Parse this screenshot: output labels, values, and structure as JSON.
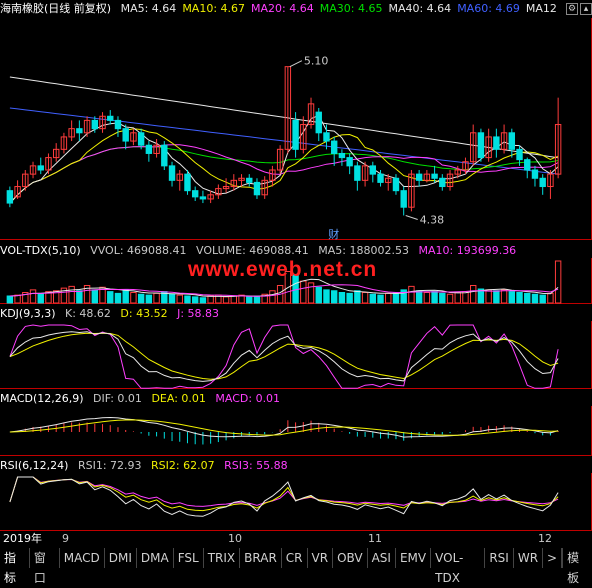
{
  "header": {
    "stock_name": "海南橡胶(日线 前复权)",
    "ma_items": [
      {
        "label": "MA5: 4.64",
        "color": "#e8e8e8"
      },
      {
        "label": "MA10: 4.67",
        "color": "#f0f000"
      },
      {
        "label": "MA20: 4.64",
        "color": "#ff40ff"
      },
      {
        "label": "MA30: 4.65",
        "color": "#00e000"
      },
      {
        "label": "MA40: 4.64",
        "color": "#e8e8e8"
      },
      {
        "label": "MA60: 4.69",
        "color": "#4060ff"
      },
      {
        "label": "MA12",
        "color": "#e8e8e8"
      }
    ]
  },
  "annotations": {
    "high": "5.10",
    "low": "4.38",
    "event": "财"
  },
  "volume_header": {
    "name": "VOL-TDX(5,10)",
    "vvol": "VVOL: 469088.41",
    "volume": "VOLUME: 469088.41",
    "ma5": "MA5: 188002.53",
    "ma10": "MA10: 193699.36"
  },
  "watermark": "www.eweb.net.cn",
  "kdj_header": {
    "name": "KDJ(9,3,3)",
    "k": "K: 48.62",
    "d": "D: 43.52",
    "j": "J: 58.83"
  },
  "macd_header": {
    "name": "MACD(12,26,9)",
    "dif": "DIF: 0.01",
    "dea": "DEA: 0.01",
    "macd": "MACD: 0.01"
  },
  "rsi_header": {
    "name": "RSI(6,12,24)",
    "rsi1": "RSI1: 72.93",
    "rsi2": "RSI2: 62.07",
    "rsi3": "RSI3: 55.88"
  },
  "dates": {
    "year": "2019年",
    "m9": "9",
    "m10": "10",
    "m11": "11",
    "m12": "12"
  },
  "tabs": [
    "指标",
    "窗口",
    "MACD",
    "DMI",
    "DMA",
    "FSL",
    "TRIX",
    "BRAR",
    "CR",
    "VR",
    "OBV",
    "ASI",
    "EMV",
    "VOL-TDX",
    "RSI",
    "WR",
    ">"
  ],
  "template_tab": "模板",
  "colors": {
    "up": "#ff3c3c",
    "down": "#00e0e0",
    "bg": "#000000",
    "grid": "#c00000"
  },
  "chart_data": {
    "type": "candlestick",
    "ylim": [
      4.3,
      5.2
    ],
    "candles": [
      [
        4.5,
        4.44,
        4.52,
        4.42
      ],
      [
        4.47,
        4.52,
        4.55,
        4.46
      ],
      [
        4.52,
        4.58,
        4.6,
        4.5
      ],
      [
        4.58,
        4.62,
        4.64,
        4.56
      ],
      [
        4.62,
        4.6,
        4.66,
        4.58
      ],
      [
        4.6,
        4.66,
        4.68,
        4.58
      ],
      [
        4.66,
        4.7,
        4.73,
        4.64
      ],
      [
        4.7,
        4.76,
        4.78,
        4.68
      ],
      [
        4.76,
        4.8,
        4.84,
        4.74
      ],
      [
        4.8,
        4.78,
        4.84,
        4.74
      ],
      [
        4.78,
        4.84,
        4.86,
        4.76
      ],
      [
        4.84,
        4.8,
        4.86,
        4.78
      ],
      [
        4.8,
        4.86,
        4.88,
        4.78
      ],
      [
        4.86,
        4.84,
        4.89,
        4.82
      ],
      [
        4.84,
        4.8,
        4.86,
        4.76
      ],
      [
        4.8,
        4.74,
        4.82,
        4.7
      ],
      [
        4.74,
        4.78,
        4.8,
        4.72
      ],
      [
        4.78,
        4.72,
        4.8,
        4.7
      ],
      [
        4.72,
        4.68,
        4.74,
        4.64
      ],
      [
        4.68,
        4.72,
        4.75,
        4.66
      ],
      [
        4.72,
        4.62,
        4.74,
        4.6
      ],
      [
        4.62,
        4.55,
        4.64,
        4.52
      ],
      [
        4.55,
        4.58,
        4.6,
        4.5
      ],
      [
        4.58,
        4.5,
        4.6,
        4.48
      ],
      [
        4.5,
        4.47,
        4.52,
        4.45
      ],
      [
        4.47,
        4.46,
        4.5,
        4.44
      ],
      [
        4.46,
        4.48,
        4.5,
        4.44
      ],
      [
        4.48,
        4.51,
        4.53,
        4.46
      ],
      [
        4.51,
        4.52,
        4.56,
        4.49
      ],
      [
        4.52,
        4.55,
        4.58,
        4.5
      ],
      [
        4.55,
        4.56,
        4.58,
        4.52
      ],
      [
        4.56,
        4.54,
        4.58,
        4.52
      ],
      [
        4.54,
        4.48,
        4.56,
        4.46
      ],
      [
        4.48,
        4.55,
        4.57,
        4.46
      ],
      [
        4.55,
        4.6,
        4.62,
        4.52
      ],
      [
        4.6,
        4.7,
        4.72,
        4.58
      ],
      [
        4.7,
        5.1,
        5.1,
        4.68
      ],
      [
        4.84,
        4.7,
        4.88,
        4.66
      ],
      [
        4.7,
        4.82,
        4.86,
        4.68
      ],
      [
        4.82,
        4.92,
        4.95,
        4.8
      ],
      [
        4.88,
        4.78,
        4.9,
        4.74
      ],
      [
        4.78,
        4.74,
        4.82,
        4.7
      ],
      [
        4.74,
        4.68,
        4.76,
        4.62
      ],
      [
        4.68,
        4.66,
        4.7,
        4.62
      ],
      [
        4.66,
        4.62,
        4.68,
        4.58
      ],
      [
        4.62,
        4.55,
        4.64,
        4.5
      ],
      [
        4.55,
        4.62,
        4.64,
        4.52
      ],
      [
        4.62,
        4.58,
        4.64,
        4.54
      ],
      [
        4.58,
        4.54,
        4.6,
        4.52
      ],
      [
        4.54,
        4.56,
        4.58,
        4.5
      ],
      [
        4.56,
        4.5,
        4.58,
        4.48
      ],
      [
        4.5,
        4.42,
        4.52,
        4.38
      ],
      [
        4.42,
        4.58,
        4.6,
        4.4
      ],
      [
        4.58,
        4.55,
        4.6,
        4.52
      ],
      [
        4.55,
        4.58,
        4.6,
        4.54
      ],
      [
        4.58,
        4.56,
        4.62,
        4.54
      ],
      [
        4.56,
        4.52,
        4.58,
        4.5
      ],
      [
        4.52,
        4.58,
        4.6,
        4.5
      ],
      [
        4.58,
        4.6,
        4.62,
        4.56
      ],
      [
        4.6,
        4.64,
        4.66,
        4.58
      ],
      [
        4.64,
        4.78,
        4.82,
        4.62
      ],
      [
        4.78,
        4.66,
        4.8,
        4.64
      ],
      [
        4.66,
        4.76,
        4.8,
        4.64
      ],
      [
        4.76,
        4.7,
        4.8,
        4.66
      ],
      [
        4.7,
        4.78,
        4.82,
        4.68
      ],
      [
        4.78,
        4.7,
        4.8,
        4.66
      ],
      [
        4.7,
        4.65,
        4.72,
        4.62
      ],
      [
        4.65,
        4.6,
        4.66,
        4.56
      ],
      [
        4.6,
        4.56,
        4.62,
        4.52
      ],
      [
        4.56,
        4.52,
        4.58,
        4.48
      ],
      [
        4.52,
        4.58,
        4.6,
        4.46
      ],
      [
        4.58,
        4.82,
        4.95,
        4.56
      ]
    ],
    "volume": [
      16,
      18,
      24,
      30,
      22,
      26,
      28,
      34,
      38,
      28,
      40,
      30,
      36,
      26,
      22,
      30,
      24,
      20,
      18,
      22,
      26,
      20,
      18,
      16,
      14,
      12,
      16,
      18,
      14,
      16,
      18,
      14,
      16,
      20,
      28,
      40,
      72,
      64,
      50,
      46,
      36,
      30,
      28,
      24,
      22,
      28,
      24,
      20,
      18,
      22,
      24,
      30,
      38,
      28,
      24,
      26,
      22,
      20,
      24,
      26,
      40,
      32,
      30,
      28,
      30,
      26,
      24,
      22,
      20,
      18,
      22,
      96
    ]
  }
}
